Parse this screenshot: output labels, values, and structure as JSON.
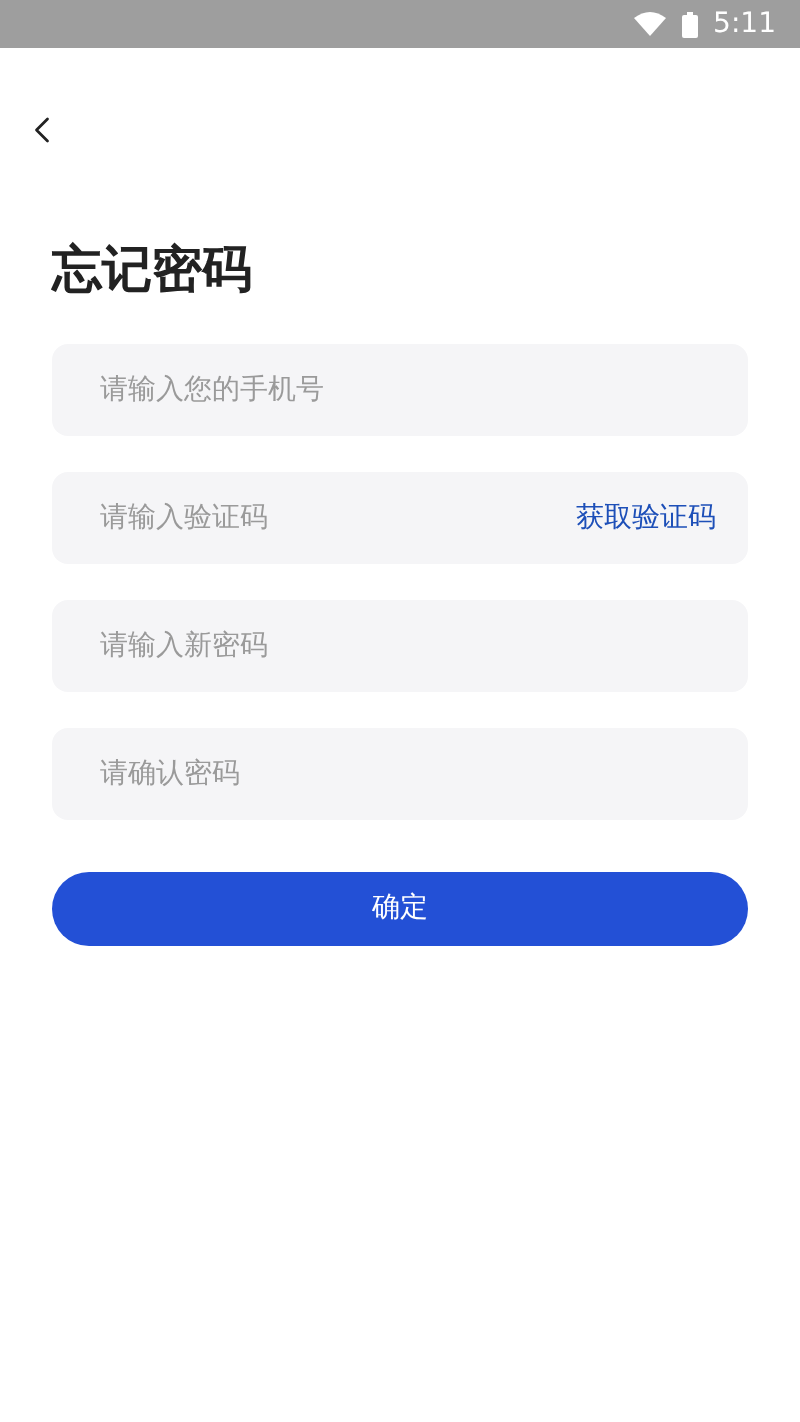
{
  "status_bar": {
    "time": "5:11"
  },
  "title": "忘记密码",
  "fields": [
    {
      "kind": "plain",
      "placeholder": "请输入您的手机号"
    },
    {
      "kind": "code",
      "placeholder": "请输入验证码",
      "action": "获取验证码"
    },
    {
      "kind": "password",
      "placeholder": "请输入新密码"
    },
    {
      "kind": "password",
      "placeholder": "请确认密码"
    }
  ],
  "submit": "确定"
}
